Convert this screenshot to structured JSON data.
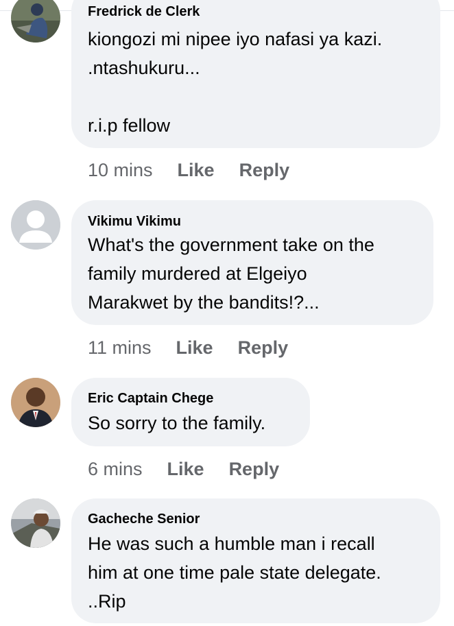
{
  "colors": {
    "bubble_background": "#f0f2f5",
    "meta_text": "#65676b",
    "body_text": "#050505"
  },
  "comments": [
    {
      "author": "Fredrick de Clerk",
      "text": "kiongozi mi nipee iyo nafasi ya kazi.\n.ntashukuru...\n\nr.i.p fellow",
      "time": "10 mins",
      "like_label": "Like",
      "reply_label": "Reply",
      "avatar": "profile-photo-icon"
    },
    {
      "author": "Vikimu Vikimu",
      "text": "What's the government take on the\nfamily murdered at Elgeiyo\nMarakwet by the bandits!?...",
      "time": "11 mins",
      "like_label": "Like",
      "reply_label": "Reply",
      "avatar": "default-profile-icon"
    },
    {
      "author": "Eric Captain Chege",
      "text": "So sorry to the family.",
      "time": "6 mins",
      "like_label": "Like",
      "reply_label": "Reply",
      "avatar": "profile-photo-icon"
    },
    {
      "author": "Gacheche Senior",
      "text": "He was such a humble man i recall\nhim at one time pale state delegate.\n..Rip",
      "time": "",
      "like_label": "",
      "reply_label": "",
      "avatar": "profile-photo-icon"
    }
  ]
}
